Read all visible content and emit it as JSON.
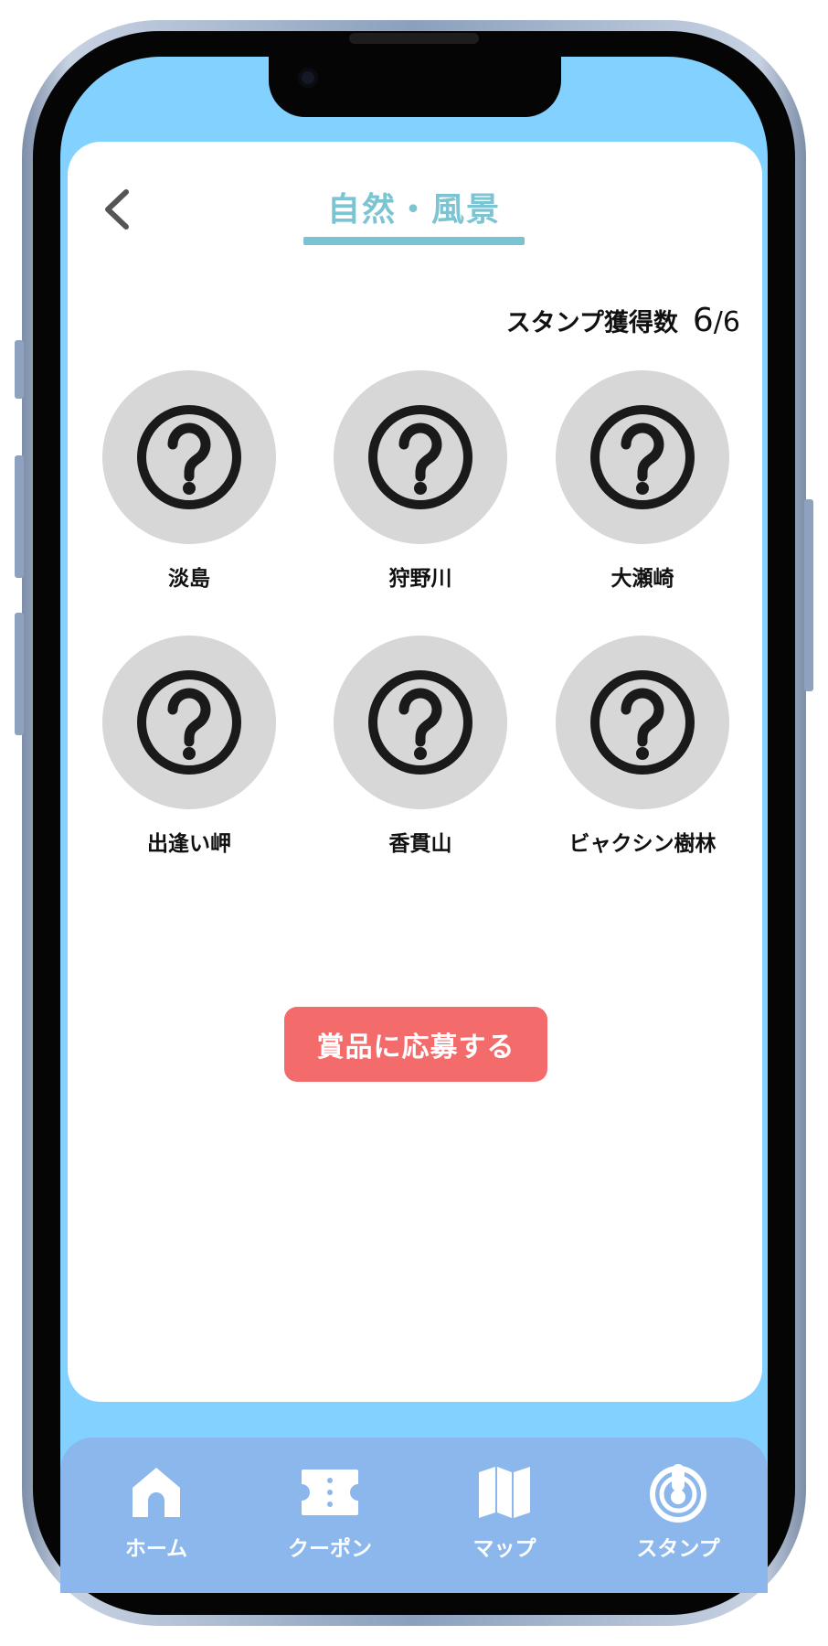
{
  "colors": {
    "background_sky": "#83d1fe",
    "card": "#ffffff",
    "title": "#7dc4d2",
    "stamp_circle": "#d7d7d7",
    "apply_button": "#f36b6b",
    "tabbar": "#8bb7ec"
  },
  "header": {
    "back_icon": "chevron-left-icon",
    "title": "自然・風景"
  },
  "stamp_count": {
    "label": "スタンプ獲得数",
    "value": "6",
    "slash": "/",
    "total": "6"
  },
  "stamps": [
    {
      "name": "淡島",
      "icon": "question-circle-icon"
    },
    {
      "name": "狩野川",
      "icon": "question-circle-icon"
    },
    {
      "name": "大瀬崎",
      "icon": "question-circle-icon"
    },
    {
      "name": "出逢い岬",
      "icon": "question-circle-icon"
    },
    {
      "name": "香貫山",
      "icon": "question-circle-icon"
    },
    {
      "name": "ビャクシン樹林",
      "icon": "question-circle-icon"
    }
  ],
  "apply_button": {
    "label": "賞品に応募する"
  },
  "tabbar": {
    "items": [
      {
        "label": "ホーム",
        "icon": "home-icon"
      },
      {
        "label": "クーポン",
        "icon": "ticket-icon"
      },
      {
        "label": "マップ",
        "icon": "map-icon"
      },
      {
        "label": "スタンプ",
        "icon": "stamp-icon"
      }
    ]
  }
}
